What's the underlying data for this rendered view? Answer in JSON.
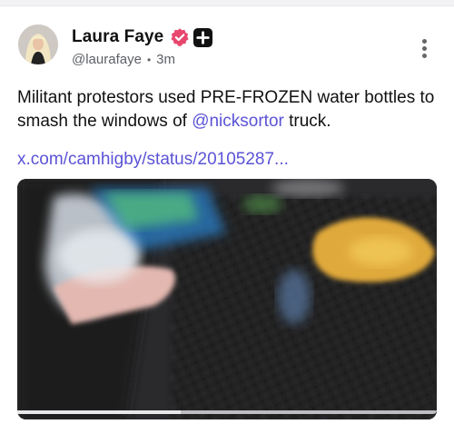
{
  "post": {
    "author_name": "Laura Faye",
    "handle": "@laurafaye",
    "separator": "•",
    "time": "3m",
    "text_before": "Militant protestors used PRE-FROZEN water bottles to smash the windows of ",
    "mention": "@nicksortor",
    "text_after": " truck.",
    "link": "x.com/camhigby/status/20105287..."
  },
  "media": {
    "progress": 0.39
  },
  "colors": {
    "accent": "#5b53d6",
    "verified": "#e8476d",
    "plus_badge": "#111111"
  }
}
